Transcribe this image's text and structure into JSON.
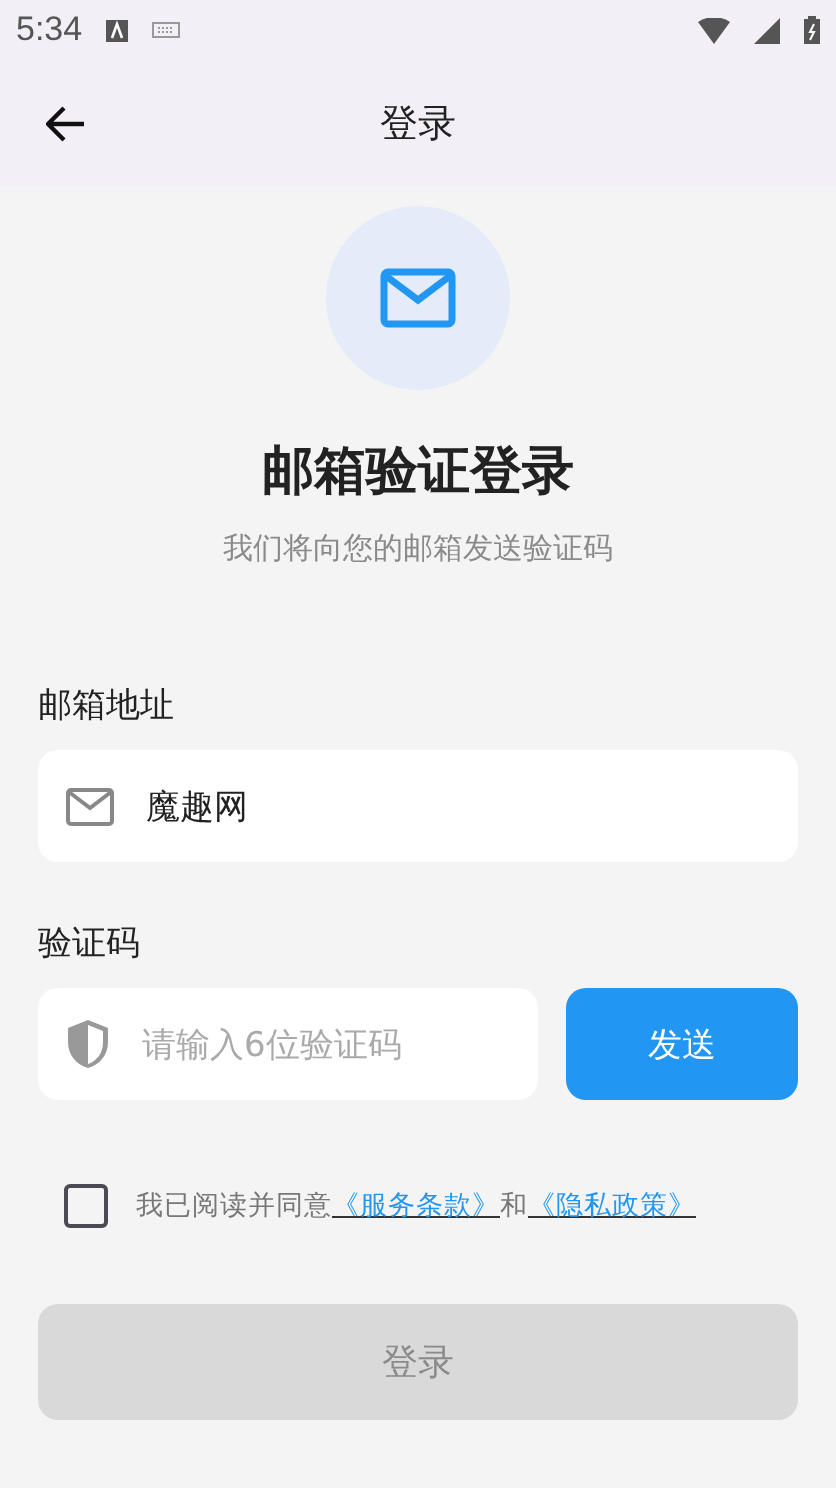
{
  "status_bar": {
    "time": "5:34"
  },
  "app_bar": {
    "title": "登录"
  },
  "header": {
    "title": "邮箱验证登录",
    "subtitle": "我们将向您的邮箱发送验证码"
  },
  "email": {
    "label": "邮箱地址",
    "value": "魔趣网"
  },
  "code": {
    "label": "验证码",
    "placeholder": "请输入6位验证码",
    "send_button": "发送"
  },
  "agreement": {
    "checked": false,
    "text": "我已阅读并同意",
    "terms_link": "《服务条款》",
    "conjunction": "和",
    "privacy_link": "《隐私政策》"
  },
  "login_button": {
    "label": "登录",
    "disabled": true
  }
}
